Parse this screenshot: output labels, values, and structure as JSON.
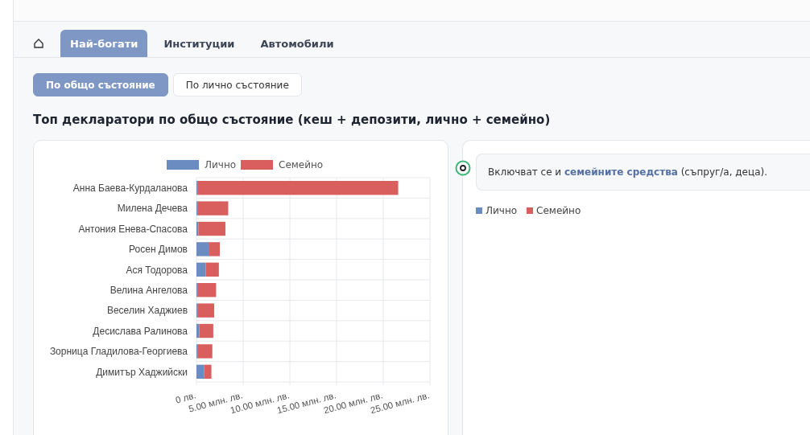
{
  "tabs": [
    {
      "kind": "home",
      "selected": false
    },
    {
      "label": "Най-богати",
      "selected": true
    },
    {
      "label": "Институции",
      "selected": false
    },
    {
      "label": "Автомобили",
      "selected": false
    }
  ],
  "toggles": [
    {
      "label": "По общо състояние",
      "selected": true
    },
    {
      "label": "По лично състояние",
      "selected": false
    }
  ],
  "heading": "Топ декларатори по общо състояние (кеш + депозити, лично + семейно)",
  "chart_data": {
    "type": "bar",
    "orientation": "horizontal",
    "stacked": true,
    "categories": [
      "Анна Баева-Курдаланова",
      "Милена Дечева",
      "Антония Енева-Спасова",
      "Росен Димов",
      "Ася Тодорова",
      "Велина Ангелова",
      "Веселин Хаджиев",
      "Десислава Ралинова",
      "Зорница Гладилова-Георгиева",
      "Димитър Хаджийски"
    ],
    "series": [
      {
        "name": "Лично",
        "color": "#6b8cc0",
        "values": [
          0.1,
          0.1,
          0.2,
          1.3,
          1.0,
          0.1,
          0.1,
          0.3,
          0.1,
          0.8
        ]
      },
      {
        "name": "Семейно",
        "color": "#d95f5f",
        "values": [
          21.5,
          3.3,
          2.9,
          1.2,
          1.4,
          2.0,
          1.8,
          1.5,
          1.6,
          0.8
        ]
      }
    ],
    "grid": true,
    "legend": true,
    "xlim": [
      0,
      25
    ],
    "xticks": [
      {
        "value": 0,
        "label": "0 лв."
      },
      {
        "value": 5,
        "label": "5.00 млн. лв."
      },
      {
        "value": 10,
        "label": "10.00 млн. лв."
      },
      {
        "value": 15,
        "label": "15.00 млн. лв."
      },
      {
        "value": 20,
        "label": "20.00 млн. лв."
      },
      {
        "value": 25,
        "label": "25.00 млн. лв."
      }
    ]
  },
  "note": "Включват се и **семейните средства** (съпруг/а, деца).",
  "legend": [
    {
      "label": "Лично",
      "color": "#6b8cc0"
    },
    {
      "label": "Семейно",
      "color": "#d95f5f"
    }
  ]
}
